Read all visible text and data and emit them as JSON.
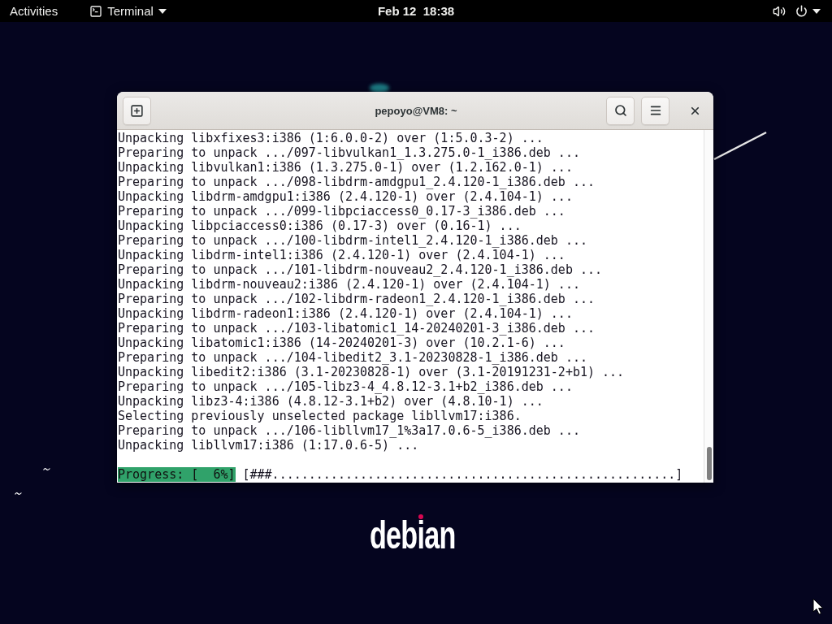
{
  "top_bar": {
    "activities": "Activities",
    "app_menu": "Terminal",
    "clock": "Feb 12  18:38"
  },
  "window": {
    "title": "pepoyo@VM8: ~",
    "lines": [
      "Unpacking libxfixes3:i386 (1:6.0.0-2) over (1:5.0.3-2) ...",
      "Preparing to unpack .../097-libvulkan1_1.3.275.0-1_i386.deb ...",
      "Unpacking libvulkan1:i386 (1.3.275.0-1) over (1.2.162.0-1) ...",
      "Preparing to unpack .../098-libdrm-amdgpu1_2.4.120-1_i386.deb ...",
      "Unpacking libdrm-amdgpu1:i386 (2.4.120-1) over (2.4.104-1) ...",
      "Preparing to unpack .../099-libpciaccess0_0.17-3_i386.deb ...",
      "Unpacking libpciaccess0:i386 (0.17-3) over (0.16-1) ...",
      "Preparing to unpack .../100-libdrm-intel1_2.4.120-1_i386.deb ...",
      "Unpacking libdrm-intel1:i386 (2.4.120-1) over (2.4.104-1) ...",
      "Preparing to unpack .../101-libdrm-nouveau2_2.4.120-1_i386.deb ...",
      "Unpacking libdrm-nouveau2:i386 (2.4.120-1) over (2.4.104-1) ...",
      "Preparing to unpack .../102-libdrm-radeon1_2.4.120-1_i386.deb ...",
      "Unpacking libdrm-radeon1:i386 (2.4.120-1) over (2.4.104-1) ...",
      "Preparing to unpack .../103-libatomic1_14-20240201-3_i386.deb ...",
      "Unpacking libatomic1:i386 (14-20240201-3) over (10.2.1-6) ...",
      "Preparing to unpack .../104-libedit2_3.1-20230828-1_i386.deb ...",
      "Unpacking libedit2:i386 (3.1-20230828-1) over (3.1-20191231-2+b1) ...",
      "Preparing to unpack .../105-libz3-4_4.8.12-3.1+b2_i386.deb ...",
      "Unpacking libz3-4:i386 (4.8.12-3.1+b2) over (4.8.10-1) ...",
      "Selecting previously unselected package libllvm17:i386.",
      "Preparing to unpack .../106-libllvm17_1%3a17.0.6-5_i386.deb ...",
      "Unpacking libllvm17:i386 (1:17.0.6-5) ..."
    ],
    "progress": {
      "label": "Progress: [  6%]",
      "bar": "[###.......................................................]"
    }
  },
  "wallpaper": {
    "logo": "debian"
  }
}
